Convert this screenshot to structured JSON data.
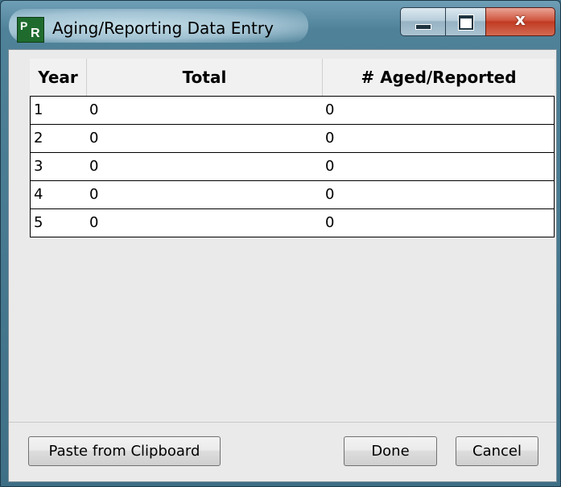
{
  "window": {
    "title": "Aging/Reporting Data Entry",
    "icon_letters": {
      "p": "P",
      "r": "R"
    },
    "caption_buttons": {
      "close_glyph": "x"
    }
  },
  "grid": {
    "columns": [
      "Year",
      "Total",
      "# Aged/Reported"
    ],
    "rows": [
      {
        "year": "1",
        "total": "0",
        "aged": "0"
      },
      {
        "year": "2",
        "total": "0",
        "aged": "0"
      },
      {
        "year": "3",
        "total": "0",
        "aged": "0"
      },
      {
        "year": "4",
        "total": "0",
        "aged": "0"
      },
      {
        "year": "5",
        "total": "0",
        "aged": "0"
      }
    ]
  },
  "buttons": {
    "paste": "Paste from Clipboard",
    "done": "Done",
    "cancel": "Cancel"
  },
  "colors": {
    "titlebar": "#4f8299",
    "close_button": "#c13a22",
    "client_bg": "#eaeaea",
    "icon_bg": "#1f6b2e"
  }
}
